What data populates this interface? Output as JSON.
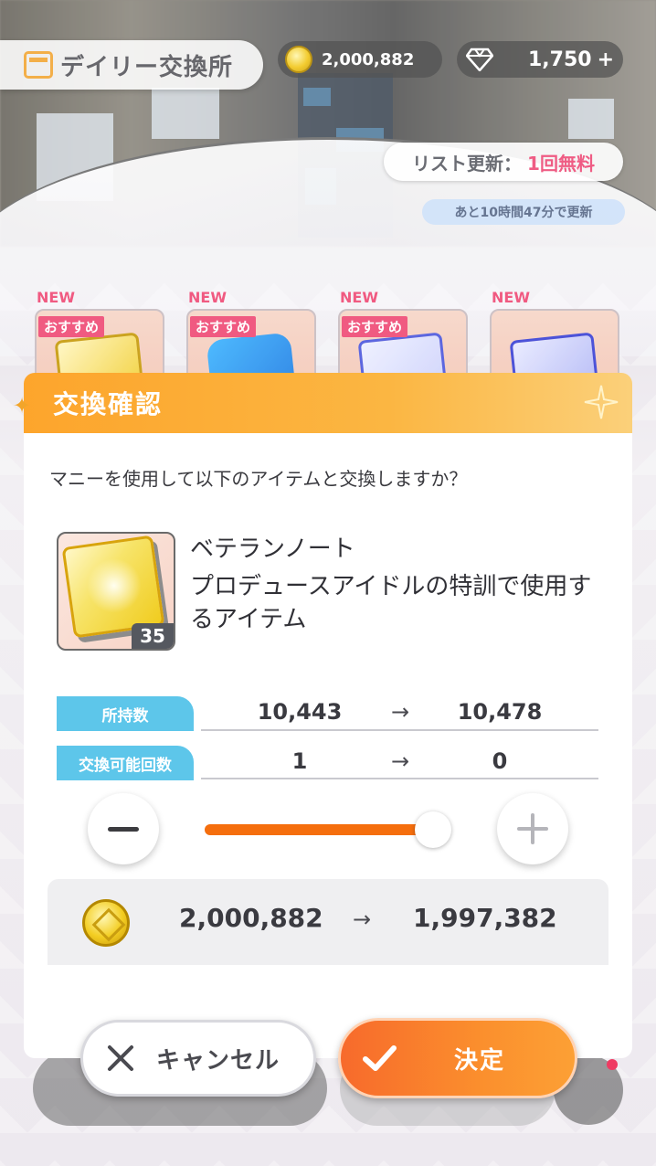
{
  "hud": {
    "shop_title": "デイリー交換所",
    "coins": "2,000,882",
    "gems": "1,750",
    "gems_plus": "+",
    "refresh_label": "リスト更新：",
    "refresh_free": "1回無料",
    "refresh_timer": "あと10時間47分で更新"
  },
  "cards": [
    {
      "new": "NEW",
      "badge": "おすすめ"
    },
    {
      "new": "NEW",
      "badge": "おすすめ"
    },
    {
      "new": "NEW",
      "badge": "おすすめ"
    },
    {
      "new": "NEW",
      "badge": ""
    }
  ],
  "dialog": {
    "title": "交換確認",
    "question": "マニーを使用して以下のアイテムと交換しますか？",
    "item": {
      "name": "ベテランノート",
      "description": "プロデュースアイドルの特訓で使用するアイテム",
      "quantity": "35"
    },
    "stats": [
      {
        "label": "所持数",
        "before": "10,443",
        "arrow": "→",
        "after": "10,478"
      },
      {
        "label": "交換可能回数",
        "before": "1",
        "arrow": "→",
        "after": "0"
      }
    ],
    "slider": {
      "value": 1,
      "min": 0,
      "max": 1
    },
    "cost": {
      "before": "2,000,882",
      "arrow": "→",
      "after": "1,997,382"
    },
    "cancel_label": "キャンセル",
    "confirm_label": "決定"
  },
  "colors": {
    "header_orange": "#fda52c",
    "stat_label_blue": "#5dc6ea",
    "slider_fill": "#f56e0d",
    "confirm_orange": "#f76a2c",
    "new_pink": "#ef4d77"
  },
  "icons": [
    "calendar-icon",
    "coin-icon",
    "gem-icon",
    "sparkle-icon",
    "minus-icon",
    "plus-icon",
    "close-icon",
    "check-icon",
    "menu-icon"
  ]
}
